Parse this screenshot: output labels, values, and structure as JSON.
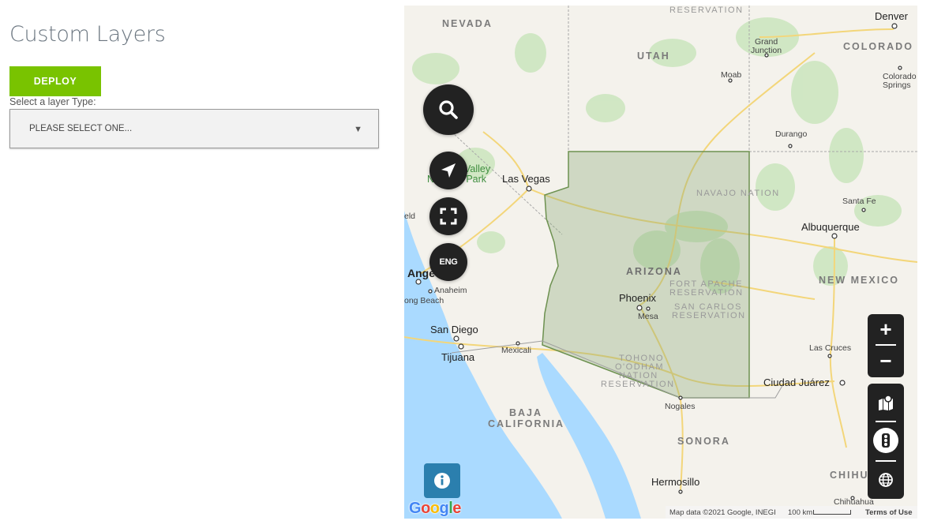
{
  "page": {
    "title": "Custom Layers",
    "deploy_label": "DEPLOY",
    "select_label": "Select a layer Type:",
    "select_value": "PLEASE SELECT ONE...",
    "select_caret": "▼"
  },
  "colors": {
    "deploy_green": "#79c300",
    "title_grey": "#6b7680",
    "map_control_dark": "#222222",
    "info_blue": "#2b7fae",
    "arizona_highlight": "#7a9a5e"
  },
  "map": {
    "controls": {
      "search_icon": "search-icon",
      "locate_icon": "navigation-arrow-icon",
      "fullscreen_icon": "fullscreen-icon",
      "language_label": "ENG",
      "zoom_in": "+",
      "zoom_out": "−",
      "map_type_icon": "map-pin-icon",
      "traffic_icon": "traffic-light-icon",
      "globe_icon": "globe-icon",
      "info_icon": "info-icon"
    },
    "regions": {
      "nevada": "NEVADA",
      "utah": "UTAH",
      "colorado": "COLORADO",
      "arizona": "ARIZONA",
      "new_mexico": "NEW MEXICO",
      "baja_line1": "BAJA",
      "baja_line2": "CALIFORNIA",
      "sonora": "SONORA",
      "chihuahua_cut": "CHIHU",
      "reservation_top": "RESERVATION",
      "navajo": "NAVAJO NATION",
      "fort_apache_1": "FORT APACHE",
      "fort_apache_2": "RESERVATION",
      "san_carlos_1": "SAN CARLOS",
      "san_carlos_2": "RESERVATION",
      "tohono_1": "TOHONO",
      "tohono_2": "O'ODHAM",
      "tohono_3": "NATION",
      "tohono_4": "RESERVATION"
    },
    "cities": {
      "denver": "Denver",
      "grand_junction_1": "Grand",
      "grand_junction_2": "Junction",
      "moab": "Moab",
      "colorado_springs_1": "Colorado",
      "colorado_springs_2": "Springs",
      "durango": "Durango",
      "death_valley_1": "Valley",
      "death_valley_2": "National Park",
      "las_vegas": "Las Vegas",
      "santa_fe": "Santa Fe",
      "albuquerque": "Albuquerque",
      "field_cut": "eld",
      "los_angeles_cut": "Ange",
      "anaheim": "Anaheim",
      "long_beach_cut": "ong Beach",
      "phoenix": "Phoenix",
      "mesa": "Mesa",
      "san_diego": "San Diego",
      "tijuana": "Tijuana",
      "mexicali": "Mexicali",
      "las_cruces": "Las Cruces",
      "ciudad_juarez": "Ciudad Juárez",
      "nogales": "Nogales",
      "hermosillo": "Hermosillo",
      "chihuahua": "Chihuahua"
    },
    "attribution": {
      "logo": "Google",
      "data": "Map data ©2021 Google, INEGI",
      "scale": "100 km",
      "terms": "Terms of Use"
    }
  }
}
